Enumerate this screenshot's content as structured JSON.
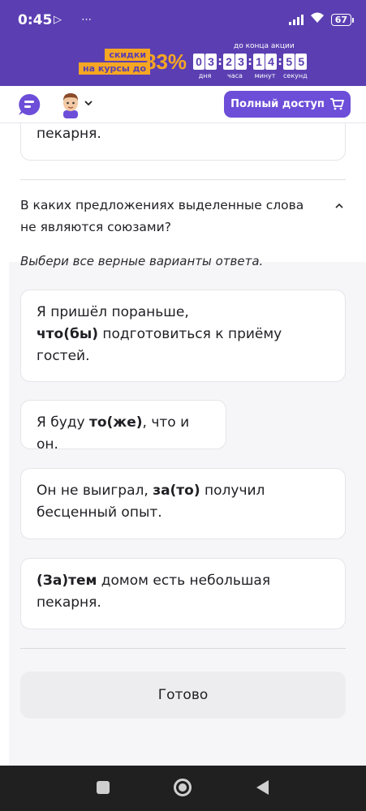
{
  "status_bar": {
    "time": "0:45",
    "left_icons": "▷ ⋯",
    "battery": "67"
  },
  "promo": {
    "tag_1": "скидки",
    "tag_2": "на курсы до",
    "percent": "83%",
    "until_label": "до конца акции",
    "countdown": [
      {
        "d1": "0",
        "d2": "3",
        "label": "дня"
      },
      {
        "d1": "2",
        "d2": "3",
        "label": "часа"
      },
      {
        "d1": "1",
        "d2": "4",
        "label": "минут"
      },
      {
        "d1": "5",
        "d2": "5",
        "label": "секунд"
      }
    ]
  },
  "header": {
    "full_access_label": "Полный доступ"
  },
  "prev_card_text": "пекарня.",
  "question": "В каких предложениях выделенные слова не являются союзами?",
  "instruction": "Выбери все верные варианты ответа.",
  "options": [
    {
      "pre": "Я пришёл пораньше,",
      "bold": "что(бы)",
      "post": " подготовиться к приёму гостей."
    },
    {
      "pre": "Я буду ",
      "bold": "то(же)",
      "post": ", что и он."
    },
    {
      "pre": "Он не выиграл, ",
      "bold": "за(то)",
      "post": " получил бесценный опыт."
    },
    {
      "pre": "",
      "bold": "(За)тем",
      "post": " домом есть небольшая пекарня."
    }
  ],
  "done_label": "Готово",
  "colors": {
    "brand_purple": "#5b3fb2",
    "button_purple": "#6c4ed8",
    "promo_orange": "#f5a623"
  }
}
